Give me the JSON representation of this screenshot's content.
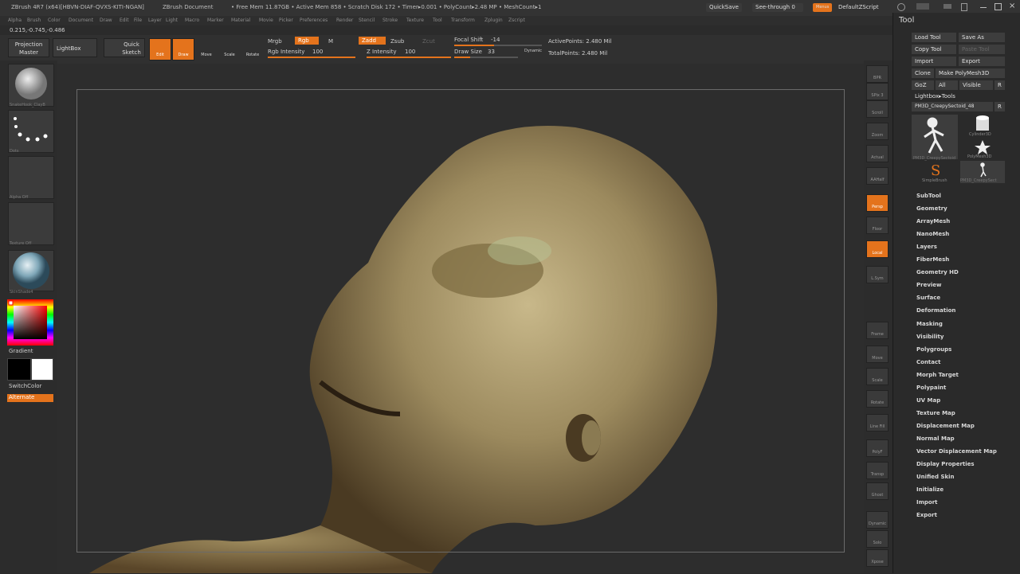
{
  "titlebar": {
    "app": "ZBrush 4R7 (x64)[HBVN-DIAF-QVXS-KITI-NGAN]",
    "doc": "ZBrush Document",
    "stats": "• Free Mem 11.87GB • Active Mem 858 • Scratch Disk 172 • Timer▸0.001 • PolyCount▸2.48 MP • MeshCount▸1",
    "quicksave": "QuickSave",
    "seethrough": "See-through",
    "seethrough_value": "0",
    "menus_label": "Menus",
    "script": "DefaultZScript"
  },
  "menubar": [
    "Alpha",
    "Brush",
    "Color",
    "Document",
    "Draw",
    "Edit",
    "File",
    "Layer",
    "Light",
    "Macro",
    "Marker",
    "Material",
    "Movie",
    "Picker",
    "Preferences",
    "Render",
    "Stencil",
    "Stroke",
    "Texture",
    "Tool",
    "Transform",
    "Zplugin",
    "Zscript"
  ],
  "coords": "0.215,-0.745,-0.486",
  "toolbar": {
    "projection_master": "Projection Master",
    "lightbox": "LightBox",
    "quick_sketch": "Quick Sketch",
    "edit": "Edit",
    "draw": "Draw",
    "move": "Move",
    "scale": "Scale",
    "rotate": "Rotate",
    "mrgb": "Mrgb",
    "rgb": "Rgb",
    "m": "M",
    "rgb_intensity_label": "Rgb Intensity",
    "rgb_intensity_value": "100",
    "zadd": "Zadd",
    "zsub": "Zsub",
    "zcut": "Zcut",
    "z_intensity_label": "Z Intensity",
    "z_intensity_value": "100",
    "focal_shift_label": "Focal Shift",
    "focal_shift_value": "-14",
    "draw_size_label": "Draw Size",
    "draw_size_value": "33",
    "dynamic": "Dynamic",
    "active_points": "ActivePoints: 2.480 Mil",
    "total_points": "TotalPoints: 2.480 Mil"
  },
  "leftshelf": {
    "brush_caption": "SnakeHook_ClayB",
    "stroke_caption": "Dots",
    "alpha_caption": "Alpha Off",
    "texture_caption": "Texture Off",
    "material_caption": "SkinShade4",
    "gradient": "Gradient",
    "switchcolor": "SwitchColor",
    "alternate": "Alternate"
  },
  "rightshelf": [
    "BPR",
    "SPix 3",
    "Scroll",
    "Zoom",
    "Actual",
    "AAHalf",
    "Persp",
    "Floor",
    "Local",
    "L.Sym",
    "Frame",
    "Move",
    "Scale",
    "Rotate",
    "Line Fill",
    "PolyF",
    "Transp",
    "Ghost",
    "Dynamic",
    "Solo",
    "Xpose"
  ],
  "palette": {
    "title": "Tool",
    "load_tool": "Load Tool",
    "save_as": "Save As",
    "copy_tool": "Copy Tool",
    "paste_tool": "Paste Tool",
    "import": "Import",
    "export": "Export",
    "clone": "Clone",
    "make_polymesh": "Make PolyMesh3D",
    "goz": "GoZ",
    "all": "All",
    "visible": "Visible",
    "r": "R",
    "lightbox_tools": "Lightbox▸Tools",
    "current_tool": "PM3D_CreepySectoid_48",
    "thumbs": [
      "PM3D_CreepySectoid",
      "Cylinder3D",
      "PolyMesh3D",
      "SimpleBrush",
      "PM3D_CreepySect"
    ],
    "items": [
      "SubTool",
      "Geometry",
      "ArrayMesh",
      "NanoMesh",
      "Layers",
      "FiberMesh",
      "Geometry HD",
      "Preview",
      "Surface",
      "Deformation",
      "Masking",
      "Visibility",
      "Polygroups",
      "Contact",
      "Morph Target",
      "Polypaint",
      "UV Map",
      "Texture Map",
      "Displacement Map",
      "Normal Map",
      "Vector Displacement Map",
      "Display Properties",
      "Unified Skin",
      "Initialize",
      "Import",
      "Export"
    ]
  },
  "colors": {
    "accent": "#e4731c",
    "bg": "#2b2b2b",
    "model": "#9c8a5e"
  }
}
